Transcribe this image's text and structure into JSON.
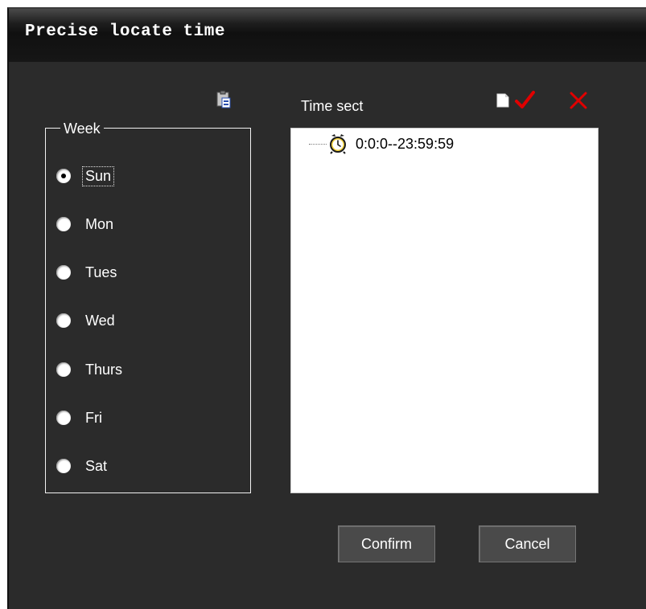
{
  "window": {
    "title": "Precise locate time"
  },
  "toolbar": {
    "paste_icon": "paste-icon",
    "new_icon": "new-document-icon",
    "confirm_icon": "checkmark-icon",
    "delete_icon": "delete-x-icon"
  },
  "time_sect": {
    "label": "Time sect",
    "items": [
      {
        "icon": "clock-icon",
        "text": "0:0:0--23:59:59"
      }
    ]
  },
  "week": {
    "legend": "Week",
    "selected": "Sun",
    "days": [
      "Sun",
      "Mon",
      "Tues",
      "Wed",
      "Thurs",
      "Fri",
      "Sat"
    ]
  },
  "buttons": {
    "confirm": "Confirm",
    "cancel": "Cancel"
  },
  "colors": {
    "background": "#2b2b2b",
    "accent_check": "#e00000",
    "accent_delete": "#e00000"
  }
}
